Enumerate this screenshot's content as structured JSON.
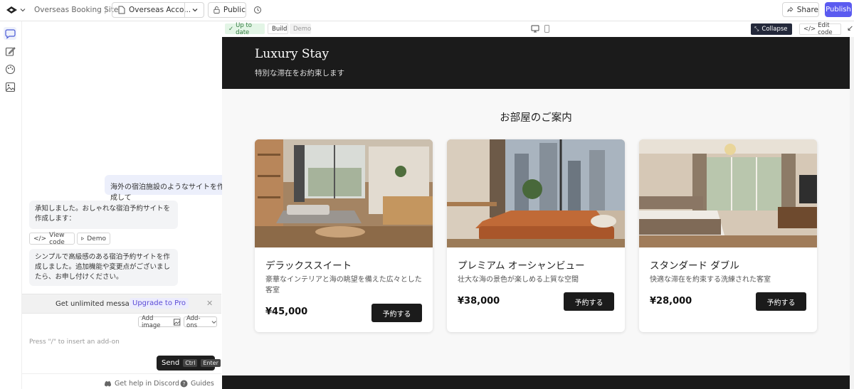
{
  "topbar": {
    "site_name": "Overseas Booking Site",
    "separator": "/",
    "page_tab": "Overseas Acco...",
    "visibility": "Public",
    "share": "Share",
    "publish": "Publish"
  },
  "chat": {
    "user_message": "海外の宿泊施設のようなサイトを作成して",
    "assistant_message_1": "承知しました。おしゃれな宿泊予約サイトを作成します：",
    "view_code": "View code",
    "demo": "Demo",
    "assistant_message_2": "シンプルで高級感のある宿泊予約サイトを作成しました。追加機能や変更点がございましたら、お申し付けください。",
    "upgrade_text": "Get unlimited messages",
    "upgrade_link": "Upgrade to Pro",
    "add_image": "Add image",
    "add_ons": "Add-ons",
    "placeholder": "Press \"/\" to insert an add-on",
    "send": "Send",
    "kbd_ctrl": "Ctrl",
    "kbd_enter": "Enter",
    "discord": "Get help in Discord",
    "guides": "Guides"
  },
  "preview_toolbar": {
    "status": "Up to date",
    "build": "Build",
    "demo": "Demo",
    "collapse": "Collapse",
    "edit_code": "Edit code"
  },
  "site": {
    "brand": "Luxury Stay",
    "tagline": "特別な滞在をお約束します",
    "section_title": "お部屋のご案内",
    "rooms": [
      {
        "name": "デラックススイート",
        "desc": "豪華なインテリアと海の眺望を備えた広々とした客室",
        "price": "¥45,000",
        "button": "予約する"
      },
      {
        "name": "プレミアム オーシャンビュー",
        "desc": "壮大な海の景色が楽しめる上質な空間",
        "price": "¥38,000",
        "button": "予約する"
      },
      {
        "name": "スタンダード ダブル",
        "desc": "快適な滞在を約束する洗練された客室",
        "price": "¥28,000",
        "button": "予約する"
      }
    ]
  },
  "colors": {
    "accent": "#5b5bf0",
    "dark": "#1b1b1b",
    "status_green": "#2f9e44"
  }
}
